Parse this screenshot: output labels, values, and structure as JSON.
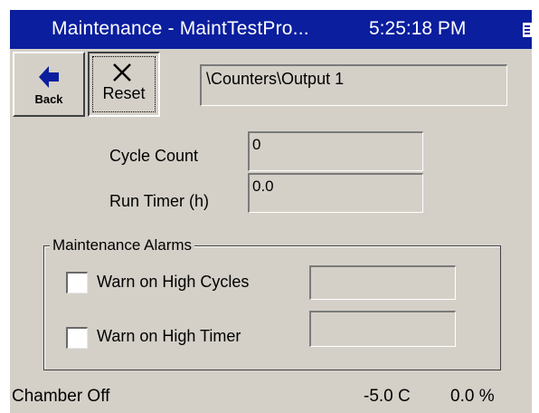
{
  "titlebar": {
    "title": "Maintenance - MaintTestPro...",
    "time": "5:25:18 PM",
    "menu_icon": "start-menu-icon",
    "color": "#0a1e9e"
  },
  "toolbar": {
    "back_label": "Back",
    "back_icon": "left-arrow-icon",
    "reset_label": "Reset",
    "reset_icon": "x-cross-icon"
  },
  "path": {
    "value": "\\Counters\\Output 1"
  },
  "counters": {
    "cycle_count_label": "Cycle Count",
    "cycle_count_value": "0",
    "run_timer_label": "Run Timer (h)",
    "run_timer_value": "0.0"
  },
  "alarms": {
    "title": "Maintenance Alarms",
    "items": [
      {
        "label": "Warn on High Cycles",
        "checked": false,
        "value": ""
      },
      {
        "label": "Warn on High Timer",
        "checked": false,
        "value": ""
      }
    ]
  },
  "status": {
    "chamber": "Chamber Off",
    "temperature": "-5.0 C",
    "percent": "0.0 %"
  }
}
